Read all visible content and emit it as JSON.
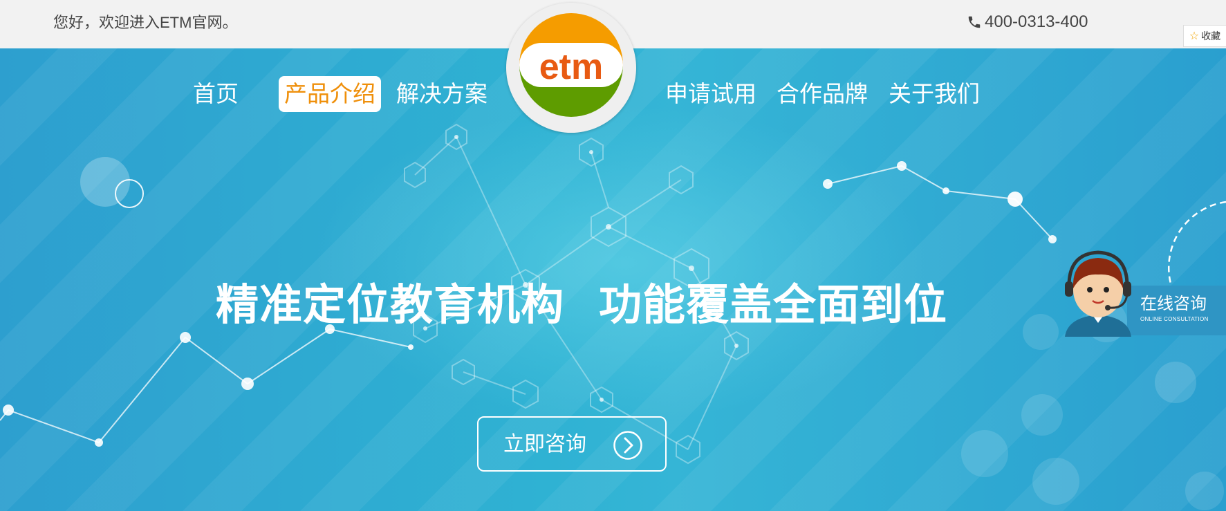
{
  "topbar": {
    "welcome": "您好，欢迎进入ETM官网。",
    "phone_icon": "phone-icon",
    "phone": "400-0313-400",
    "favorite_label": "收藏",
    "favorite_icon": "star-icon"
  },
  "logo": {
    "text": "etm",
    "colors": {
      "top": "#f59c00",
      "bottom": "#5e9c00",
      "text": "#e85a12"
    }
  },
  "nav": {
    "items": [
      {
        "label": "首页",
        "active": false
      },
      {
        "label": "产品介绍",
        "active": true
      },
      {
        "label": "解决方案",
        "active": false
      },
      {
        "label": "申请试用",
        "active": false
      },
      {
        "label": "合作品牌",
        "active": false
      },
      {
        "label": "关于我们",
        "active": false
      }
    ]
  },
  "hero": {
    "headline_left": "精准定位教育机构",
    "headline_right": "功能覆盖全面到位",
    "cta_label": "立即咨询",
    "cta_icon": "chevron-right-circle-icon"
  },
  "support": {
    "title": "在线咨询",
    "subtitle": "ONLINE CONSULTATION",
    "icon": "customer-service-avatar-icon"
  },
  "colors": {
    "topbar_bg": "#f2f2f2",
    "hero_bg": "#2aa9cf",
    "accent": "#ef8f0a",
    "support_bg": "#2f95c4"
  }
}
